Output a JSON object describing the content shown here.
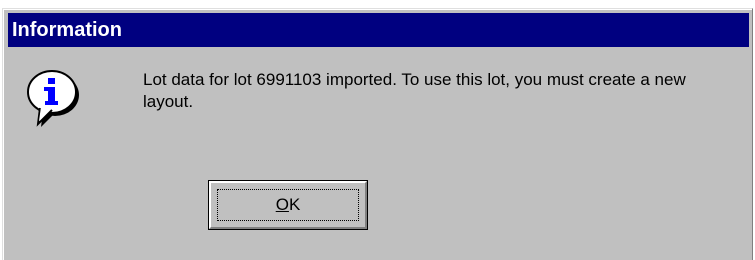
{
  "dialog": {
    "title": "Information",
    "icon": "information-icon",
    "message": "Lot data for lot 6991103 imported. To use this lot, you must create a new layout.",
    "ok_button": {
      "mnemonic": "O",
      "rest": "K"
    }
  },
  "colors": {
    "titlebar": "#000080",
    "title_text": "#ffffff",
    "dialog_face": "#c0c0c0",
    "icon_fill": "#ffffff",
    "icon_glyph": "#0000ff"
  }
}
